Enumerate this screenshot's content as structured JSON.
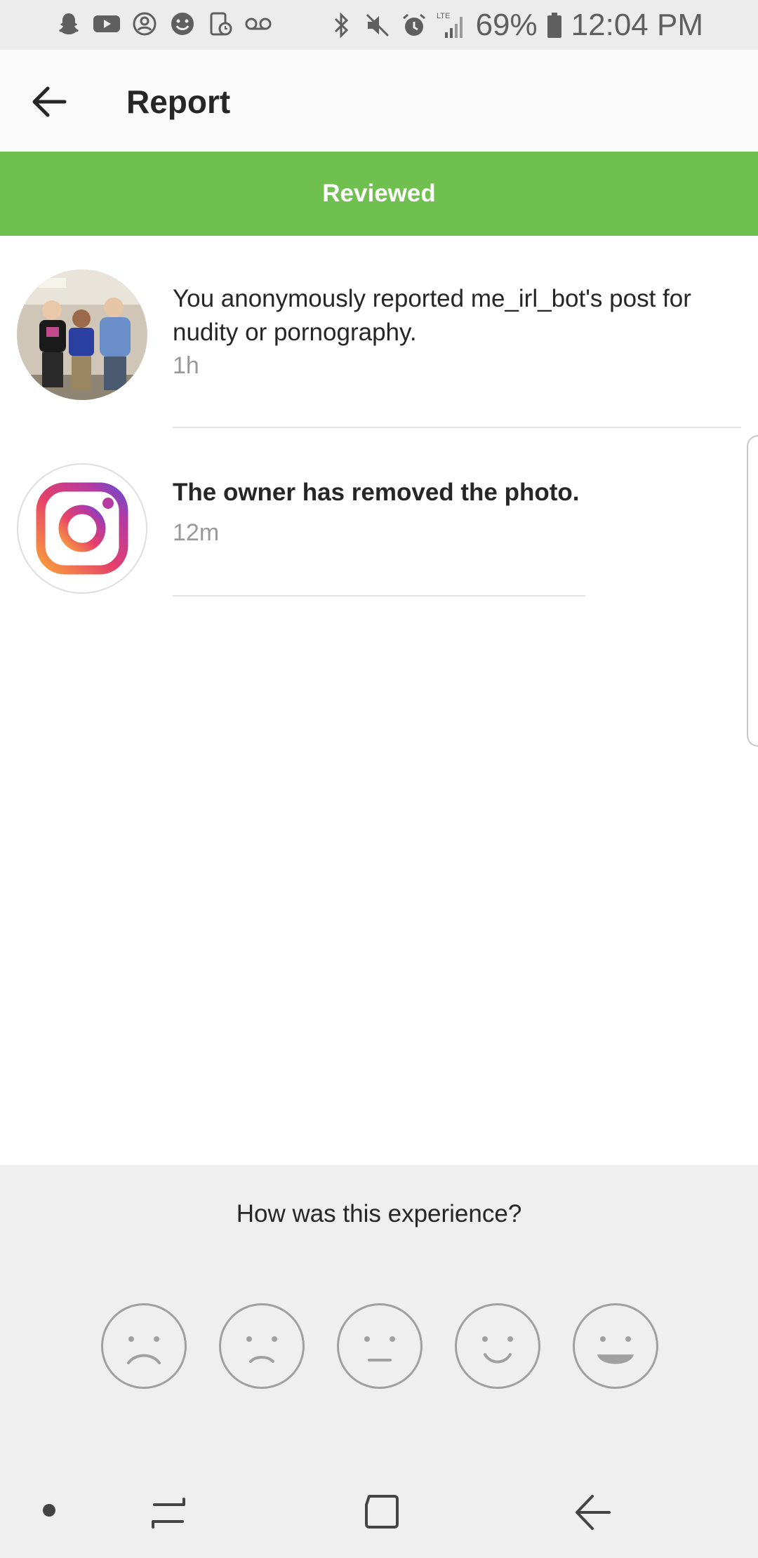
{
  "status_bar": {
    "battery": "69%",
    "time": "12:04 PM",
    "network": "LTE",
    "left_icons": [
      "snapchat-icon",
      "youtube-icon",
      "account-circle-icon",
      "smiley-icon",
      "tablet-clock-icon",
      "voicemail-icon"
    ],
    "right_icons": [
      "bluetooth-icon",
      "mute-icon",
      "alarm-icon",
      "signal-icon",
      "battery-icon"
    ]
  },
  "header": {
    "title": "Report"
  },
  "banner": {
    "label": "Reviewed",
    "color": "#70c050"
  },
  "items": [
    {
      "text": "You anonymously reported me_irl_bot's post for nudity or pornography.",
      "time": "1h",
      "avatar": "group-photo"
    },
    {
      "text": "The owner has removed the photo.",
      "time": "12m",
      "avatar": "instagram-logo"
    }
  ],
  "feedback": {
    "question": "How was this experience?",
    "faces": [
      "very-sad-face-icon",
      "sad-face-icon",
      "neutral-face-icon",
      "smile-face-icon",
      "big-smile-face-icon"
    ]
  },
  "nav_bar": {
    "buttons": [
      "dot-icon",
      "recent-apps-icon",
      "home-icon",
      "back-icon"
    ]
  }
}
